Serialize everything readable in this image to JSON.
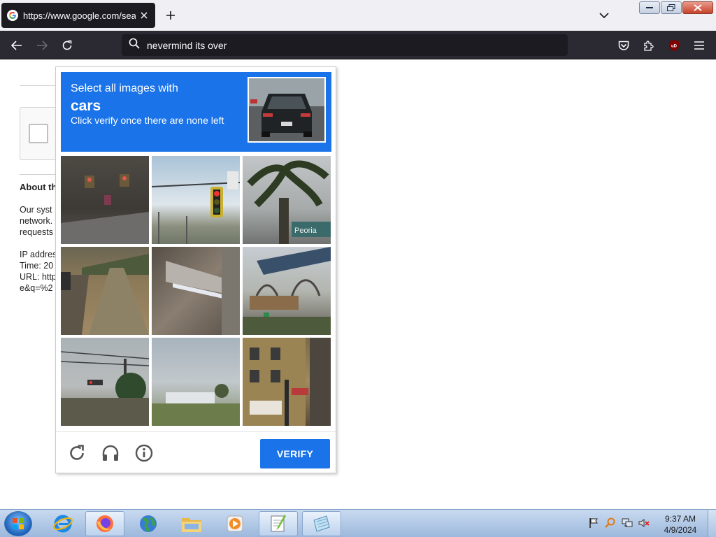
{
  "browser": {
    "tab_title": "https://www.google.com/search",
    "address_value": "nevermind its over",
    "icons": {
      "favicon": "google-g-icon",
      "tab_close": "close-icon",
      "new_tab": "plus-icon",
      "list_tabs": "chevron-down-icon",
      "back": "arrow-left-icon",
      "forward": "arrow-right-icon",
      "reload": "reload-icon",
      "search": "search-icon",
      "pocket": "pocket-icon",
      "extensions": "puzzle-icon",
      "ublock": "ublock-origin-icon",
      "menu": "hamburger-menu-icon"
    }
  },
  "page": {
    "about_title": "About th",
    "about_lines": [
      "Our syst",
      "network.",
      "requests"
    ],
    "ip_lines": [
      "IP addres",
      "Time: 20",
      "URL: http",
      "e&q=%2"
    ]
  },
  "challenge": {
    "instruction_line1": "Select all images with",
    "target_object": "cars",
    "instruction_line2": "Click verify once there are none left",
    "verify_label": "VERIFY",
    "footer_icons": [
      "reload-icon",
      "headphones-icon",
      "info-icon"
    ],
    "tiles": [
      {
        "id": 1,
        "desc": "traffic lights at dusk"
      },
      {
        "id": 2,
        "desc": "traffic light on pole"
      },
      {
        "id": 3,
        "desc": "palm tree and sign"
      },
      {
        "id": 4,
        "desc": "road with railing"
      },
      {
        "id": 5,
        "desc": "bridge underside"
      },
      {
        "id": 6,
        "desc": "bridge and trees"
      },
      {
        "id": 7,
        "desc": "traffic light and tree"
      },
      {
        "id": 8,
        "desc": "field and building"
      },
      {
        "id": 9,
        "desc": "street corner building"
      }
    ],
    "colors": {
      "accent": "#1a73e8"
    }
  },
  "taskbar": {
    "time": "9:37 AM",
    "date": "4/9/2024",
    "apps": [
      "internet-explorer-icon",
      "firefox-icon",
      "network-globe-icon",
      "file-explorer-icon",
      "media-player-icon",
      "notepad-plus-icon",
      "notepad-icon"
    ]
  }
}
